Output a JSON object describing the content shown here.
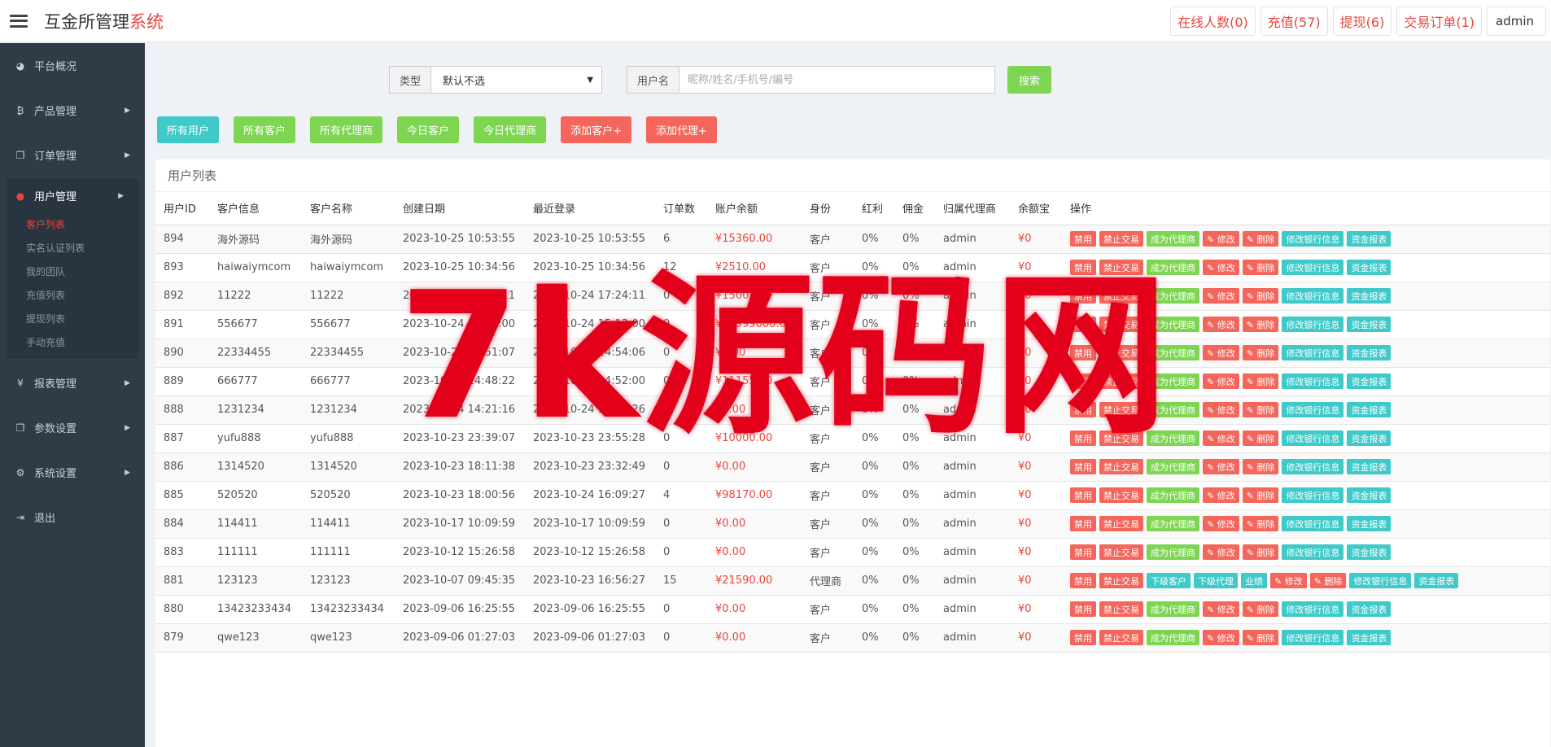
{
  "header": {
    "brand_main": "互金所管理",
    "brand_accent": "系统",
    "badges": [
      "在线人数(0)",
      "充值(57)",
      "提现(6)",
      "交易订单(1)"
    ],
    "admin": "admin"
  },
  "sidebar": {
    "items": [
      {
        "label": "平台概况",
        "icon": "dashboard-icon",
        "glyph": "◕"
      },
      {
        "label": "产品管理",
        "icon": "bitcoin-icon",
        "glyph": "₿"
      },
      {
        "label": "订单管理",
        "icon": "copy-icon",
        "glyph": "❐"
      }
    ],
    "active_group": {
      "label": "用户管理",
      "icon": "user-icon",
      "glyph": "●",
      "children": [
        "客户列表",
        "实名认证列表",
        "我的团队",
        "充值列表",
        "提现列表",
        "手动充值"
      ]
    },
    "items_after": [
      {
        "label": "报表管理",
        "icon": "yen-icon",
        "glyph": "¥"
      },
      {
        "label": "参数设置",
        "icon": "copy-icon",
        "glyph": "❐"
      },
      {
        "label": "系统设置",
        "icon": "gears-icon",
        "glyph": "⚙"
      },
      {
        "label": "退出",
        "icon": "signout-icon",
        "glyph": "⇥"
      }
    ]
  },
  "search": {
    "type_label": "类型",
    "type_value": "默认不选",
    "user_label": "用户名",
    "user_placeholder": "昵称/姓名/手机号/编号",
    "search_button": "搜索"
  },
  "filters": [
    {
      "label": "所有用户",
      "color": "cyan"
    },
    {
      "label": "所有客户",
      "color": "green"
    },
    {
      "label": "所有代理商",
      "color": "green"
    },
    {
      "label": "今日客户",
      "color": "green"
    },
    {
      "label": "今日代理商",
      "color": "green"
    },
    {
      "label": "添加客户+",
      "color": "red"
    },
    {
      "label": "添加代理+",
      "color": "red"
    }
  ],
  "panel_title": "用户列表",
  "table": {
    "columns": [
      "用户ID",
      "客户信息",
      "客户名称",
      "创建日期",
      "最近登录",
      "订单数",
      "账户余额",
      "身份",
      "红利",
      "佣金",
      "归属代理商",
      "余额宝",
      "操作"
    ],
    "ops_customer": [
      {
        "label": "禁用",
        "color": "red"
      },
      {
        "label": "禁止交易",
        "color": "red"
      },
      {
        "label": "成为代理商",
        "color": "green"
      },
      {
        "label": "✎ 修改",
        "color": "red"
      },
      {
        "label": "✎ 删除",
        "color": "red"
      },
      {
        "label": "修改银行信息",
        "color": "cyan"
      },
      {
        "label": "资金报表",
        "color": "cyan"
      }
    ],
    "ops_agent": [
      {
        "label": "禁用",
        "color": "red"
      },
      {
        "label": "禁止交易",
        "color": "red"
      },
      {
        "label": "下级客户",
        "color": "cyan"
      },
      {
        "label": "下级代理",
        "color": "cyan"
      },
      {
        "label": "业绩",
        "color": "cyan"
      },
      {
        "label": "✎ 修改",
        "color": "red"
      },
      {
        "label": "✎ 删除",
        "color": "red"
      },
      {
        "label": "修改银行信息",
        "color": "cyan"
      },
      {
        "label": "资金报表",
        "color": "cyan"
      }
    ],
    "rows": [
      {
        "id": "894",
        "info": "海外源码",
        "name": "海外源码",
        "created": "2023-10-25 10:53:55",
        "login": "2023-10-25 10:53:55",
        "orders": "6",
        "balance": "¥15360.00",
        "role": "客户",
        "bonus": "0%",
        "commission": "0%",
        "agent": "admin",
        "yuebao": "¥0",
        "ops": "customer"
      },
      {
        "id": "893",
        "info": "haiwaiymcom",
        "name": "haiwaiymcom",
        "created": "2023-10-25 10:34:56",
        "login": "2023-10-25 10:34:56",
        "orders": "12",
        "balance": "¥2510.00",
        "role": "客户",
        "bonus": "0%",
        "commission": "0%",
        "agent": "admin",
        "yuebao": "¥0",
        "ops": "customer"
      },
      {
        "id": "892",
        "info": "11222",
        "name": "11222",
        "created": "2023-10-24 17:24:11",
        "login": "2023-10-24 17:24:11",
        "orders": "0",
        "balance": "¥1500.00",
        "role": "客户",
        "bonus": "0%",
        "commission": "0%",
        "agent": "admin",
        "yuebao": "¥0",
        "ops": "customer"
      },
      {
        "id": "891",
        "info": "556677",
        "name": "556677",
        "created": "2023-10-24 15:13:00",
        "login": "2023-10-24 15:13:00",
        "orders": "0",
        "balance": "¥99999000.00",
        "role": "客户",
        "bonus": "0%",
        "commission": "0%",
        "agent": "admin",
        "yuebao": "¥0",
        "ops": "customer"
      },
      {
        "id": "890",
        "info": "22334455",
        "name": "22334455",
        "created": "2023-10-24 14:51:07",
        "login": "2023-10-24 14:54:06",
        "orders": "0",
        "balance": "¥0.00",
        "role": "客户",
        "bonus": "0%",
        "commission": "0%",
        "agent": "admin",
        "yuebao": "¥0",
        "ops": "customer"
      },
      {
        "id": "889",
        "info": "666777",
        "name": "666777",
        "created": "2023-10-24 14:48:22",
        "login": "2023-10-24 14:52:00",
        "orders": "0",
        "balance": "¥11155.00",
        "role": "客户",
        "bonus": "0%",
        "commission": "0%",
        "agent": "admin",
        "yuebao": "¥0",
        "ops": "customer"
      },
      {
        "id": "888",
        "info": "1231234",
        "name": "1231234",
        "created": "2023-10-24 14:21:16",
        "login": "2023-10-24 14:26:26",
        "orders": "0",
        "balance": "¥0.00",
        "role": "客户",
        "bonus": "0%",
        "commission": "0%",
        "agent": "admin",
        "yuebao": "¥0",
        "ops": "customer"
      },
      {
        "id": "887",
        "info": "yufu888",
        "name": "yufu888",
        "created": "2023-10-23 23:39:07",
        "login": "2023-10-23 23:55:28",
        "orders": "0",
        "balance": "¥10000.00",
        "role": "客户",
        "bonus": "0%",
        "commission": "0%",
        "agent": "admin",
        "yuebao": "¥0",
        "ops": "customer"
      },
      {
        "id": "886",
        "info": "1314520",
        "name": "1314520",
        "created": "2023-10-23 18:11:38",
        "login": "2023-10-23 23:32:49",
        "orders": "0",
        "balance": "¥0.00",
        "role": "客户",
        "bonus": "0%",
        "commission": "0%",
        "agent": "admin",
        "yuebao": "¥0",
        "ops": "customer"
      },
      {
        "id": "885",
        "info": "520520",
        "name": "520520",
        "created": "2023-10-23 18:00:56",
        "login": "2023-10-24 16:09:27",
        "orders": "4",
        "balance": "¥98170.00",
        "role": "客户",
        "bonus": "0%",
        "commission": "0%",
        "agent": "admin",
        "yuebao": "¥0",
        "ops": "customer"
      },
      {
        "id": "884",
        "info": "114411",
        "name": "114411",
        "created": "2023-10-17 10:09:59",
        "login": "2023-10-17 10:09:59",
        "orders": "0",
        "balance": "¥0.00",
        "role": "客户",
        "bonus": "0%",
        "commission": "0%",
        "agent": "admin",
        "yuebao": "¥0",
        "ops": "customer"
      },
      {
        "id": "883",
        "info": "111111",
        "name": "111111",
        "created": "2023-10-12 15:26:58",
        "login": "2023-10-12 15:26:58",
        "orders": "0",
        "balance": "¥0.00",
        "role": "客户",
        "bonus": "0%",
        "commission": "0%",
        "agent": "admin",
        "yuebao": "¥0",
        "ops": "customer"
      },
      {
        "id": "881",
        "info": "123123",
        "name": "123123",
        "created": "2023-10-07 09:45:35",
        "login": "2023-10-23 16:56:27",
        "orders": "15",
        "balance": "¥21590.00",
        "role": "代理商",
        "bonus": "0%",
        "commission": "0%",
        "agent": "admin",
        "yuebao": "¥0",
        "ops": "agent"
      },
      {
        "id": "880",
        "info": "13423233434",
        "name": "13423233434",
        "created": "2023-09-06 16:25:55",
        "login": "2023-09-06 16:25:55",
        "orders": "0",
        "balance": "¥0.00",
        "role": "客户",
        "bonus": "0%",
        "commission": "0%",
        "agent": "admin",
        "yuebao": "¥0",
        "ops": "customer"
      },
      {
        "id": "879",
        "info": "qwe123",
        "name": "qwe123",
        "created": "2023-09-06 01:27:03",
        "login": "2023-09-06 01:27:03",
        "orders": "0",
        "balance": "¥0.00",
        "role": "客户",
        "bonus": "0%",
        "commission": "0%",
        "agent": "admin",
        "yuebao": "¥0",
        "ops": "customer"
      }
    ]
  },
  "watermark": "7k源码网"
}
